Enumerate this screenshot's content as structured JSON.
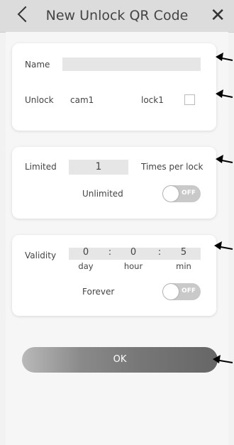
{
  "header": {
    "title": "New Unlock QR Code",
    "back_icon": "back-chevron-icon",
    "close_icon": "close-icon",
    "close_glyph": "✕"
  },
  "unlock_card": {
    "name_label": "Name",
    "name_value": "",
    "unlock_label": "Unlock",
    "camera": "cam1",
    "lock": "lock1",
    "lock_checked": false
  },
  "limit_card": {
    "limited_label": "Limited",
    "limited_value": "1",
    "times_label": "Times per lock",
    "unlimited_label": "Unlimited",
    "unlimited_toggle": "OFF"
  },
  "validity_card": {
    "validity_label": "Validity",
    "day_value": "0",
    "hour_value": "0",
    "min_value": "5",
    "separator": ":",
    "day_label": "day",
    "hour_label": "hour",
    "min_label": "min",
    "forever_label": "Forever",
    "forever_toggle": "OFF"
  },
  "ok_label": "OK"
}
